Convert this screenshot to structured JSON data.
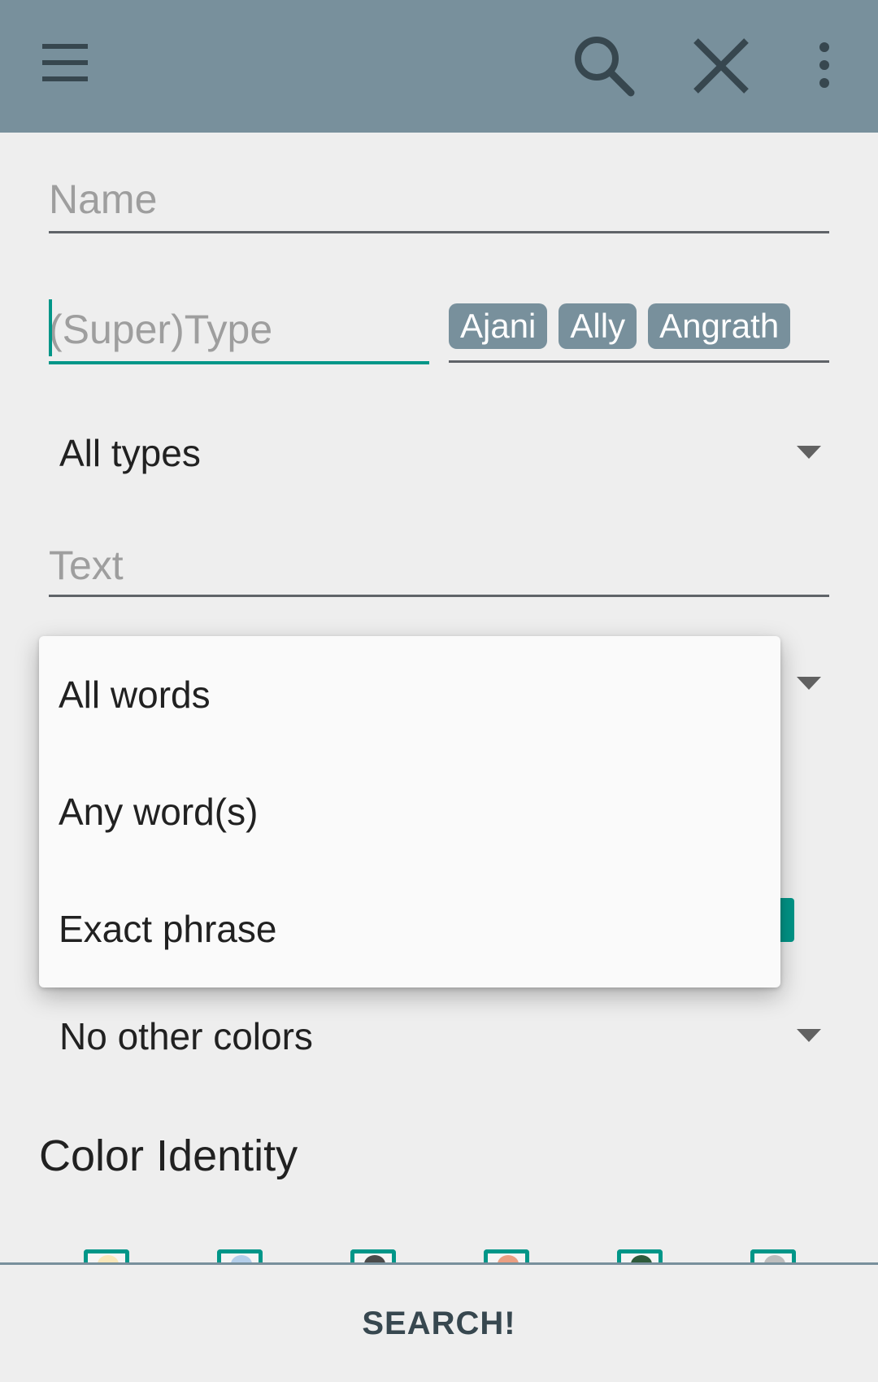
{
  "appbar": {
    "icons": [
      "menu-icon",
      "search-icon",
      "close-icon",
      "more-vert-icon"
    ],
    "background": "#78909c"
  },
  "form": {
    "name_placeholder": "Name",
    "type_placeholder": "(Super)Type",
    "chips": [
      "Ajani",
      "Ally",
      "Angrath"
    ],
    "types_spinner": "All types",
    "text_placeholder": "Text",
    "colors_spinner": "No other colors",
    "color_identity_title": "Color Identity"
  },
  "dropdown": {
    "options": [
      "All words",
      "Any word(s)",
      "Exact phrase"
    ]
  },
  "bottom": {
    "search_label": "SEARCH!"
  },
  "colors": {
    "accent": "#009688",
    "chip": "#78909c"
  }
}
